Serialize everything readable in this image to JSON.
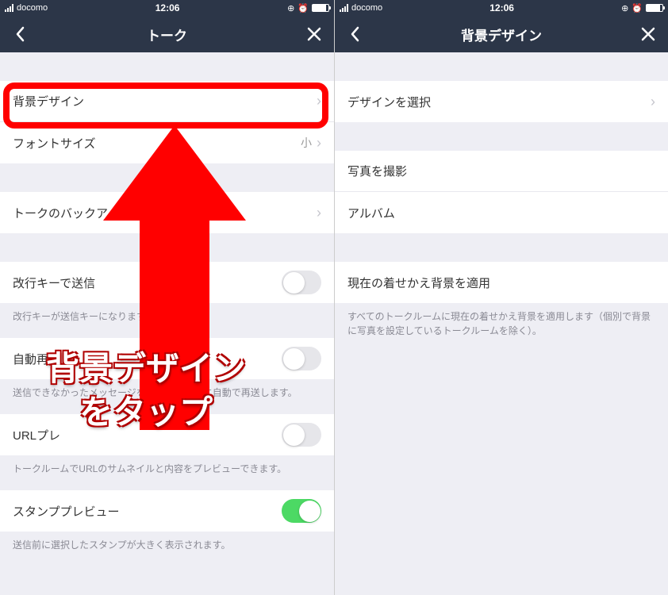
{
  "left": {
    "status": {
      "carrier": "docomo",
      "time": "12:06"
    },
    "nav": {
      "title": "トーク"
    },
    "rows": {
      "bg_design": "背景デザイン",
      "font_size_label": "フォントサイズ",
      "font_size_value": "小",
      "backup": "トークのバックアップ",
      "enter_send": "改行キーで送信",
      "enter_send_desc": "改行キーが送信キーになります。",
      "auto_resend": "自動再",
      "auto_resend_desc": "送信できなかったメッセージを、一定時間後に自動で再送します。",
      "url_preview": "URLプレ",
      "url_preview_desc": "トークルームでURLのサムネイルと内容をプレビューできます。",
      "sticker_preview": "スタンププレビュー",
      "sticker_preview_desc": "送信前に選択したスタンプが大きく表示されます。"
    }
  },
  "right": {
    "status": {
      "carrier": "docomo",
      "time": "12:06"
    },
    "nav": {
      "title": "背景デザイン"
    },
    "rows": {
      "select_design": "デザインを選択",
      "take_photo": "写真を撮影",
      "album": "アルバム",
      "apply_current": "現在の着せかえ背景を適用",
      "apply_current_desc": "すべてのトークルームに現在の着せかえ背景を適用します（個別で背景に写真を設定しているトークルームを除く）。"
    }
  },
  "callout_text_1": "背景デザイン",
  "callout_text_2": "をタップ"
}
